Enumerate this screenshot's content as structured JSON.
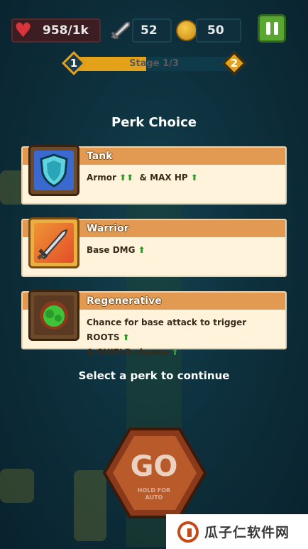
{
  "hud": {
    "hp": "958/1k",
    "attack": "52",
    "coins": "50",
    "hp_icon": "heart-icon",
    "attack_icon": "sword-icon",
    "coin_icon": "coin-icon",
    "pause_icon": "pause-icon"
  },
  "stage": {
    "label": "Stage 1/3",
    "start_node": "1",
    "end_node": "2",
    "progress": 0.45
  },
  "perk_dialog": {
    "title": "Perk Choice",
    "perks": [
      {
        "name": "Tank",
        "icon": "shield-icon",
        "line1_a": "Armor",
        "line1_a_arrows": "⬆⬆",
        "line1_b": "& MAX HP",
        "line1_b_arrows": "⬆"
      },
      {
        "name": "Warrior",
        "icon": "sword-icon",
        "line1_a": "Base DMG",
        "line1_a_arrows": "⬆"
      },
      {
        "name": "Regenerative",
        "icon": "roots-icon",
        "line1_a": "Chance for base attack to trigger ROOTS",
        "line1_a_arrows": "⬆",
        "line2_a": "& SHIELD chance",
        "line2_a_arrows": "⬆"
      }
    ],
    "footer": "Select a perk to continue"
  },
  "go_button": {
    "label": "GO",
    "sub_label_1": "HOLD FOR",
    "sub_label_2": "AUTO"
  },
  "watermark": {
    "text": "瓜子仁软件网"
  },
  "colors": {
    "card_header": "#e29a52",
    "card_body": "#fff3dc",
    "upgrade_arrow": "#2f9a2a",
    "stage_fill": "#e3a21a",
    "pause_button": "#5aa632"
  }
}
